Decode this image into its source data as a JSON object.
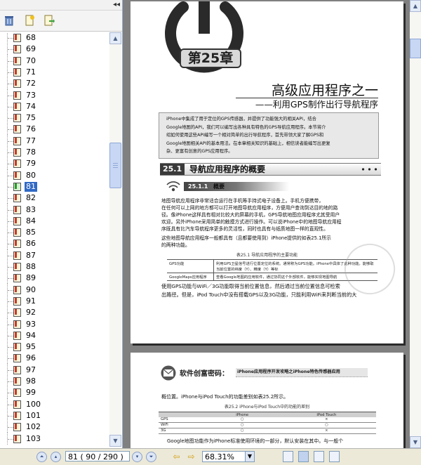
{
  "sidebar": {
    "pages": [
      "68",
      "69",
      "70",
      "71",
      "72",
      "73",
      "74",
      "75",
      "76",
      "77",
      "78",
      "79",
      "80",
      "81",
      "82",
      "83",
      "84",
      "85",
      "86",
      "87",
      "88",
      "89",
      "90",
      "91",
      "92",
      "93",
      "94",
      "95",
      "96",
      "97",
      "98",
      "99",
      "100",
      "101",
      "102",
      "103"
    ],
    "selected_page": "81"
  },
  "status": {
    "page_field": "81 ( 90 / 290 )",
    "zoom": "68.31%"
  },
  "doc": {
    "chapter_tag": "第25章",
    "title": "高级应用程序之一",
    "subtitle": "——利用GPS制作出行导航程序",
    "intro": [
      "iPhone中集成了用于定位的GPS传感器，并提供了功能强大的相关API，结合",
      "Google地图的API，我们可以编写出各种具有特色的GPS导航应用程序。本节将介",
      "绍如何使用这些API编写一个相对简单的出行导航程序，首先带领大家了解GPS和",
      "Google地图相关API的基本用法。在本章相关知识的基础上，相信读者能编写出更复",
      "杂、更富有创意的GPS应用程序。"
    ],
    "section_num": "25.1",
    "section_title": "导航应用程序的概要",
    "subsection_num": "25.1.1",
    "subsection_title": "概要",
    "para1": [
      "地图导航应用程序非常适合运行在手机等手持式电子设备上。手机方便携带，",
      "在任何可以上网的地方都可以打开地图导航应用程序，方便用户查询到达目的地的路",
      "径。像iPhone这样具有相对比较大的屏幕的手机，GPS导航地图应用程序尤其受用户",
      "欢迎。另外iPhone采用简单的触摸方式进行操作。可以说iPhone中的地图导航应用程",
      "序既具有比汽车导航程序更多的灵活性，同时也具有与纸质地图一样的直观性。"
    ],
    "para2": [
      "这些地图导航应用程序一般都具有（且都要使用到）iPhone提供的如表25.1所示",
      "的两种功能。"
    ],
    "table1_caption": "表25.1  导航应用程序的主要功能",
    "table1_rows": [
      [
        "GPS功能",
        "利用GPS卫星信号进行位置定位的系统。通常称为GPS功能。iPhone中具体了此种功能。能够取当前位置的纬度（Y）、精度（Y）等标"
      ],
      [
        "GoogleMaps应用程序",
        "查看Google地图的应用软件，通过协同这个外部软件，能够实现地图导航"
      ]
    ],
    "para3": [
      "使用GPS功能与WiFi／3G功能取得当前位置信息，然后通过当前位置信息可检索",
      "出路径。但是，iPod Touch中没有搭载GPS以及3G功能，只能利用WiFi来判断当前的大"
    ],
    "page2_secret_label": "软件创富密码：",
    "page2_secret_title": "iPhone应用程序开发攻略之iPhone特色传感器应用",
    "page2_para": "概位置。iPhone与iPod Touch的功能差别如表25.2所示。",
    "table2_caption": "表25.2  iPhone与iPod Touch中的功能的差别",
    "table2_headers": [
      "",
      "iPhone",
      "iPod Touch"
    ],
    "table2_rows": [
      [
        "GPS",
        "○",
        "×"
      ],
      [
        "WiFi",
        "○",
        "○"
      ],
      [
        "3G",
        "○",
        "×"
      ]
    ],
    "page2_para2": "Google地图功能作为iPhone标准使用环境的一部分，默认安装在其中。与一般个"
  }
}
